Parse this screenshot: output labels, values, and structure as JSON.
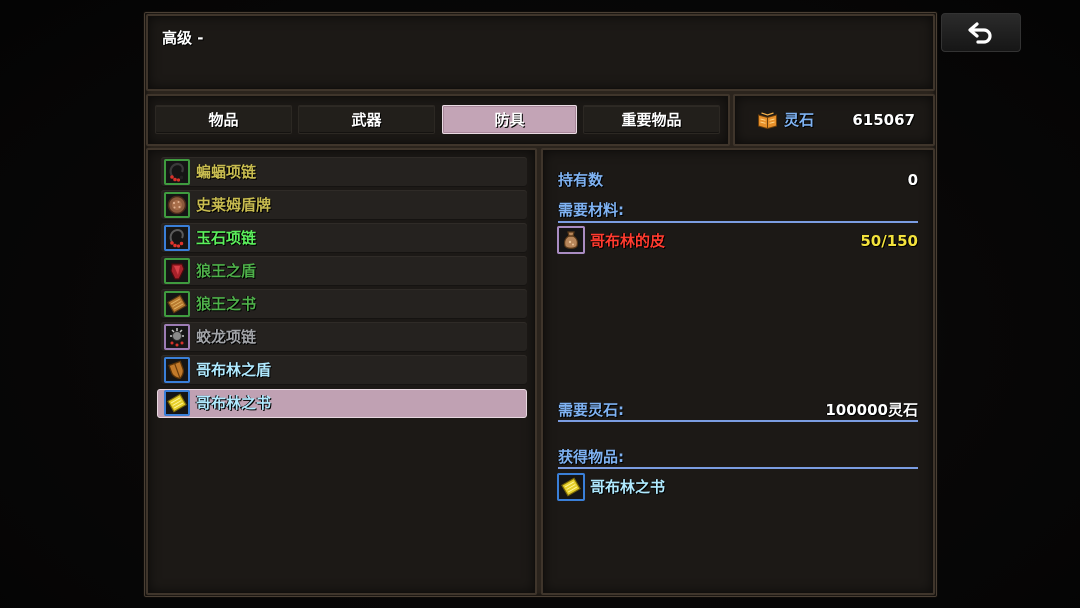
{
  "screen": {
    "title": "高级 -"
  },
  "back_button": {
    "icon": "return-arrow-icon"
  },
  "tabs": [
    {
      "label": "物品",
      "selected": false
    },
    {
      "label": "武器",
      "selected": false
    },
    {
      "label": "防具",
      "selected": true
    },
    {
      "label": "重要物品",
      "selected": false
    }
  ],
  "currency": {
    "icon": "spirit-stone-icon",
    "label": "灵石",
    "amount": "615067"
  },
  "item_list": [
    {
      "name": "蝙蝠项链",
      "icon": "bat-necklace-icon",
      "text_color": "#c8bc50",
      "frame_color": "#3f9b3f",
      "selected": false
    },
    {
      "name": "史莱姆盾牌",
      "icon": "slime-shield-icon",
      "text_color": "#c8bc50",
      "frame_color": "#3f9b3f",
      "selected": false
    },
    {
      "name": "玉石项链",
      "icon": "jade-necklace-icon",
      "text_color": "#5cf05c",
      "frame_color": "#3a7fd8",
      "selected": false
    },
    {
      "name": "狼王之盾",
      "icon": "wolf-king-shield-icon",
      "text_color": "#4fb04a",
      "frame_color": "#3f9b3f",
      "selected": false
    },
    {
      "name": "狼王之书",
      "icon": "wolf-king-book-icon",
      "text_color": "#4fb04a",
      "frame_color": "#3f9b3f",
      "selected": false
    },
    {
      "name": "蛟龙项链",
      "icon": "dragon-necklace-icon",
      "text_color": "#a2a4a8",
      "frame_color": "#9c7cb4",
      "selected": false
    },
    {
      "name": "哥布林之盾",
      "icon": "goblin-shield-icon",
      "text_color": "#b0eaff",
      "frame_color": "#3a7fd8",
      "selected": false
    },
    {
      "name": "哥布林之书",
      "icon": "goblin-book-icon",
      "text_color": "#b0eaff",
      "frame_color": "#3a7fd8",
      "selected": true
    }
  ],
  "detail": {
    "owned": {
      "label": "持有数",
      "value": "0"
    },
    "materials": {
      "label": "需要材料:",
      "items": [
        {
          "name": "哥布林的皮",
          "icon": "goblin-hide-icon",
          "quantity": "50/150",
          "name_color": "#ff3b2f",
          "quantity_color": "#f3e23c",
          "frame_color": "#a98cc2"
        }
      ]
    },
    "stone_cost": {
      "label": "需要灵石:",
      "value": "100000灵石"
    },
    "result": {
      "label": "获得物品:",
      "name": "哥布林之书",
      "icon": "goblin-book-icon",
      "name_color": "#b0eaff",
      "frame_color": "#3a7fd8"
    }
  },
  "colors": {
    "label_blue": "#7fb2f2",
    "divider_blue": "#7b9de2",
    "value_white": "#ffffff",
    "selected_highlight": "#c0a1b3",
    "panel_bg": "#1c1916",
    "panel_border": "#3f352b"
  }
}
